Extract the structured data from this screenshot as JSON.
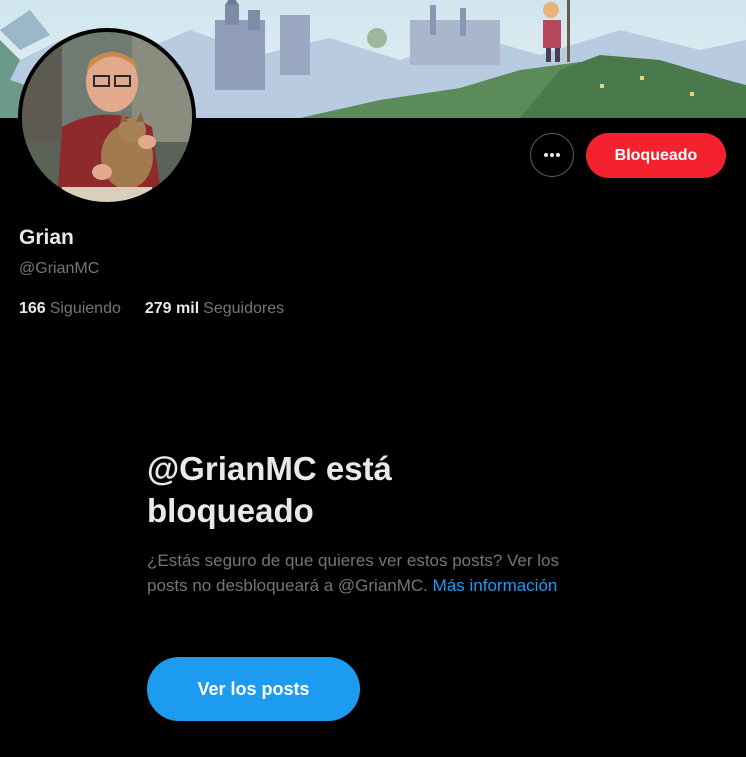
{
  "profile": {
    "display_name": "Grian",
    "handle": "@GrianMC",
    "following_count": "166",
    "following_label": "Siguiendo",
    "followers_count": "279 mil",
    "followers_label": "Seguidores"
  },
  "actions": {
    "more_icon": "more-horizontal-icon",
    "blocked_label": "Bloqueado"
  },
  "blocked_notice": {
    "title": "@GrianMC está bloqueado",
    "body": "¿Estás seguro de que quieres ver estos posts? Ver los posts no desbloqueará a @GrianMC.",
    "link_label": "Más información",
    "button_label": "Ver los posts"
  },
  "colors": {
    "background": "#000000",
    "text_primary": "#e7e9ea",
    "text_secondary": "#71767b",
    "danger": "#f4212e",
    "accent": "#1d9bf0"
  }
}
